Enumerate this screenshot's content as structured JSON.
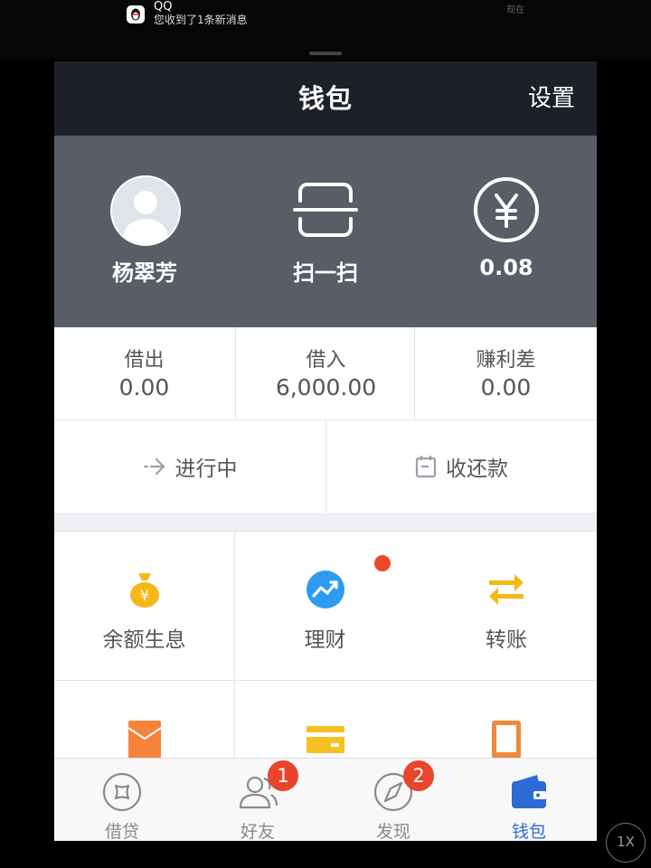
{
  "notification": {
    "app": "QQ",
    "message": "您收到了1条新消息",
    "time": "现在",
    "icon": "qq-penguin-icon"
  },
  "navbar": {
    "title": "钱包",
    "settings_label": "设置"
  },
  "hero": [
    {
      "label": "杨翠芳",
      "icon": "avatar"
    },
    {
      "label": "扫一扫",
      "icon": "scan-icon"
    },
    {
      "label": "0.08",
      "icon": "yen-circle-icon"
    }
  ],
  "stats": [
    {
      "label": "借出",
      "value": "0.00"
    },
    {
      "label": "借入",
      "value": "6,000.00"
    },
    {
      "label": "赚利差",
      "value": "0.00"
    }
  ],
  "actions": [
    {
      "label": "进行中",
      "icon": "arrow-right-icon"
    },
    {
      "label": "收还款",
      "icon": "calendar-icon"
    }
  ],
  "grid": [
    {
      "label": "余额生息",
      "icon": "money-bag-icon",
      "color": "#f6b716"
    },
    {
      "label": "理财",
      "icon": "trend-chart-icon",
      "color": "#2f9bf0",
      "dot_color": "#ea4a2b"
    },
    {
      "label": "转账",
      "icon": "transfer-icon",
      "color": "#f6b716"
    },
    {
      "label": "",
      "icon": "red-envelope-icon",
      "color": "#f7823a"
    },
    {
      "label": "",
      "icon": "card-icon",
      "color": "#f6c022"
    },
    {
      "label": "",
      "icon": "tablet-icon",
      "color": "#f08a3a"
    }
  ],
  "tabbar": [
    {
      "label": "借贷",
      "icon": "loan-tab-icon",
      "badge": ""
    },
    {
      "label": "好友",
      "icon": "friends-tab-icon",
      "badge": "1"
    },
    {
      "label": "发现",
      "icon": "compass-tab-icon",
      "badge": "2"
    },
    {
      "label": "钱包",
      "icon": "wallet-tab-icon",
      "badge": "",
      "active": true
    }
  ],
  "zoom_button": "1X",
  "colors": {
    "navbar": "#1d2127",
    "hero": "#585d66",
    "accent": "#2d6ad6",
    "badge": "#e8452c"
  }
}
